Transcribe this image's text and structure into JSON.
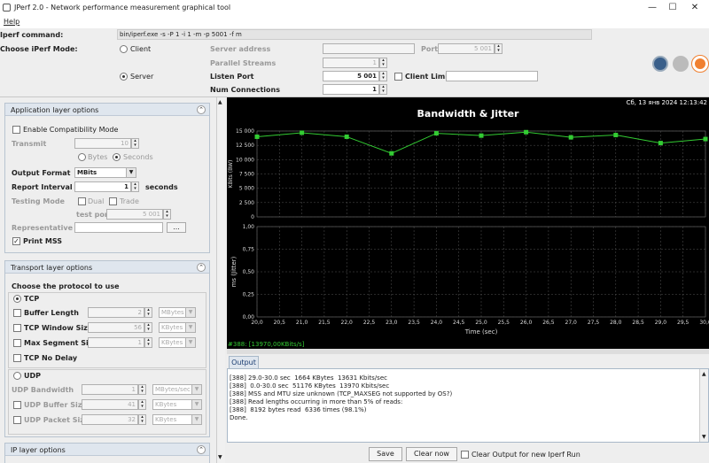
{
  "window": {
    "title": "JPerf 2.0 - Network performance measurement graphical tool",
    "min": "—",
    "max": "☐",
    "close": "✕"
  },
  "menu": {
    "help": "Help"
  },
  "top": {
    "command_label": "Iperf command:",
    "command_value": "bin/iperf.exe -s -P 1 -i 1 -m -p 5001 -f m",
    "mode_label": "Choose iPerf Mode:",
    "client_label": "Client",
    "server_label": "Server",
    "server_address_label": "Server address",
    "port_label": "Port",
    "port_value": "5 001",
    "parallel_label": "Parallel Streams",
    "parallel_value": "1",
    "listen_port_label": "Listen Port",
    "listen_port_value": "5 001",
    "client_limit_label": "Client Limit",
    "num_conn_label": "Num Connections",
    "num_conn_value": "1"
  },
  "app_layer": {
    "title": "Application layer options",
    "compat": "Enable Compatibility Mode",
    "transmit_label": "Transmit",
    "transmit_value": "10",
    "bytes": "Bytes",
    "seconds": "Seconds",
    "format_label": "Output Format",
    "format_value": "MBits",
    "interval_label": "Report Interval",
    "interval_value": "1",
    "interval_unit": "seconds",
    "testing_label": "Testing Mode",
    "dual": "Dual",
    "trade": "Trade",
    "test_port_label": "test port",
    "test_port_value": "5 001",
    "rep_file_label": "Representative File",
    "rep_file_btn": "...",
    "print_mss": "Print MSS"
  },
  "transport": {
    "title": "Transport layer options",
    "choose": "Choose the protocol to use",
    "tcp": "TCP",
    "buffer_label": "Buffer Length",
    "buffer_value": "2",
    "buffer_unit": "MBytes",
    "window_label": "TCP Window Size",
    "window_value": "56",
    "window_unit": "KBytes",
    "mss_label": "Max Segment Size",
    "mss_value": "1",
    "mss_unit": "KBytes",
    "nodelay": "TCP No Delay",
    "udp": "UDP",
    "udp_bw_label": "UDP Bandwidth",
    "udp_bw_value": "1",
    "udp_bw_unit": "MBytes/sec",
    "udp_buf_label": "UDP Buffer Size",
    "udp_buf_value": "41",
    "udp_buf_unit": "KBytes",
    "udp_pkt_label": "UDP Packet Size",
    "udp_pkt_value": "32",
    "udp_pkt_unit": "KBytes"
  },
  "ip_layer": {
    "title": "IP layer options"
  },
  "chart_data": {
    "type": "line",
    "title": "Bandwidth & Jitter",
    "timestamp": "Сб, 13 янв 2024 12:13:42",
    "xlabel": "Time (sec)",
    "ylabel_top": "KBits (BW)",
    "ylabel_bottom": "ms (Jitter)",
    "x_ticks": [
      "20,0",
      "20,5",
      "21,0",
      "21,5",
      "22,0",
      "22,5",
      "23,0",
      "23,5",
      "24,0",
      "24,5",
      "25,0",
      "25,5",
      "26,0",
      "26,5",
      "27,0",
      "27,5",
      "28,0",
      "28,5",
      "29,0",
      "29,5",
      "30,0"
    ],
    "y_ticks_top": [
      "15 000",
      "12 500",
      "10 000",
      "7 500",
      "5 000",
      "2 500",
      "0"
    ],
    "y_ticks_bottom": [
      "1,00",
      "0,75",
      "0,50",
      "0,25",
      "0,00"
    ],
    "ylim_top": [
      0,
      15000
    ],
    "ylim_bottom": [
      0,
      1
    ],
    "xlim": [
      20,
      30
    ],
    "series": [
      {
        "name": "#388: [13970,00KBits/s]",
        "color": "#33cc33",
        "x": [
          20,
          21,
          22,
          23,
          24,
          25,
          26,
          27,
          28,
          29,
          30
        ],
        "values": [
          14000,
          14700,
          14000,
          11100,
          14600,
          14200,
          14800,
          13900,
          14300,
          12900,
          13600
        ]
      }
    ],
    "grid": true,
    "legend": "bottom-left"
  },
  "output": {
    "tab": "Output",
    "lines": [
      "[388] 29.0-30.0 sec  1664 KBytes  13631 Kbits/sec",
      "[388]  0.0-30.0 sec  51176 KBytes  13970 Kbits/sec",
      "[388] MSS and MTU size unknown (TCP_MAXSEG not supported by OS?)",
      "[388] Read lengths occurring in more than 5% of reads:",
      "[388]  8192 bytes read  6336 times (98.1%)",
      "Done."
    ],
    "save": "Save",
    "clear": "Clear now",
    "clear_new": "Clear Output for new Iperf Run"
  }
}
